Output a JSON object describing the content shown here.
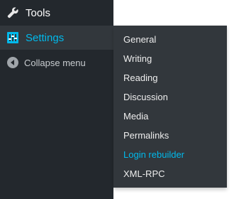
{
  "menu": {
    "tools_label": "Tools",
    "settings_label": "Settings",
    "collapse_label": "Collapse menu"
  },
  "submenu": {
    "items": [
      "General",
      "Writing",
      "Reading",
      "Discussion",
      "Media",
      "Permalinks",
      "Login rebuilder",
      "XML-RPC"
    ],
    "active_item": "Login rebuilder"
  },
  "colors": {
    "sidebar_bg": "#23282d",
    "submenu_bg": "#32373c",
    "accent": "#00b9eb",
    "text": "#eeeeee",
    "muted_icon": "#a0a5aa"
  },
  "icons": {
    "tools": "wrench-icon",
    "settings": "sliders-icon",
    "collapse": "collapse-arrow-icon"
  }
}
